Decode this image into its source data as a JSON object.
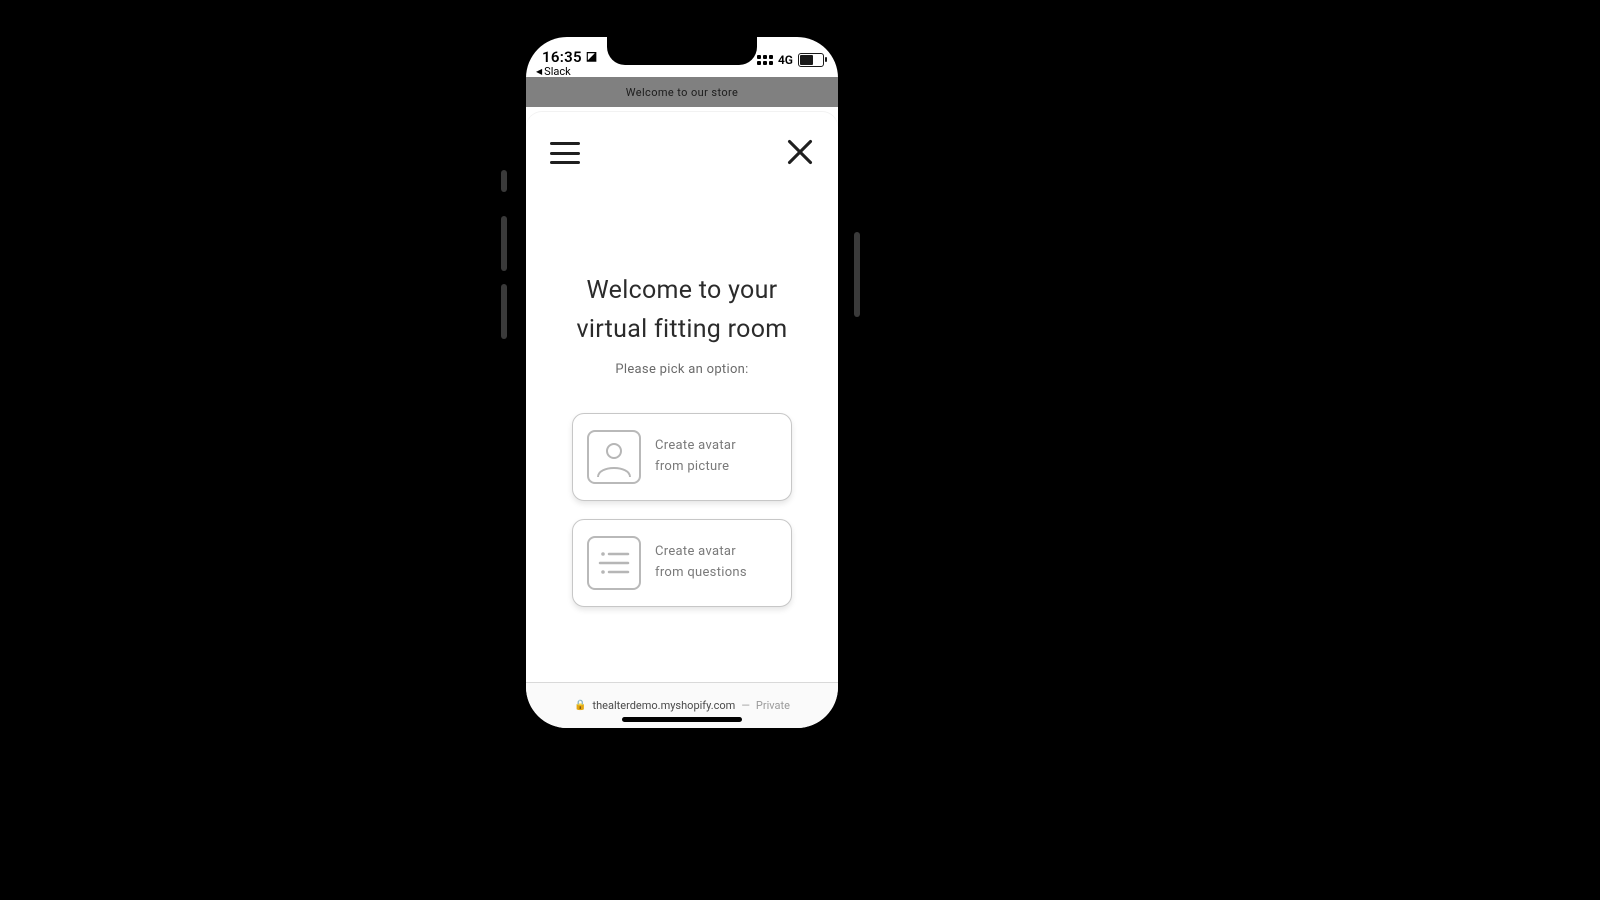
{
  "status": {
    "time": "16:35",
    "back_app": "Slack",
    "network": "4G"
  },
  "banner": {
    "text": "Welcome to our store"
  },
  "sheet": {
    "title": "Welcome to your virtual fitting room",
    "subtitle": "Please pick an option:",
    "options": [
      {
        "line1": "Create avatar",
        "line2": "from picture"
      },
      {
        "line1": "Create avatar",
        "line2": "from questions"
      }
    ]
  },
  "browser": {
    "url": "thealterdemo.myshopify.com",
    "separator": "—",
    "mode": "Private"
  }
}
